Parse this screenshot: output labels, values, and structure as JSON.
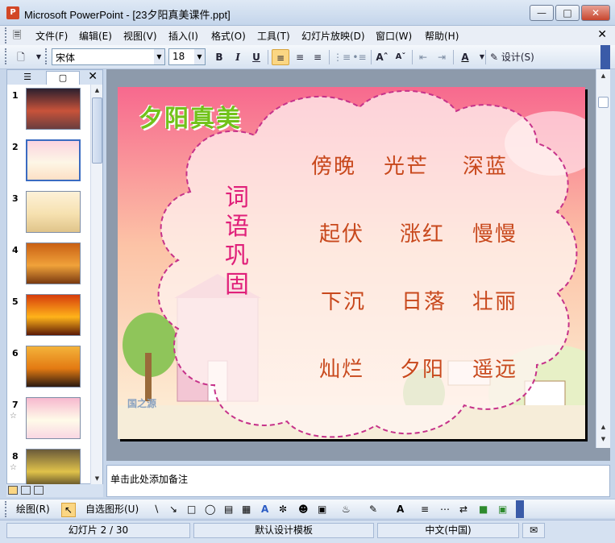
{
  "window": {
    "title": "Microsoft PowerPoint - [23夕阳真美课件.ppt]",
    "app_icon_glyph": "P"
  },
  "menu": [
    "文件(F)",
    "编辑(E)",
    "视图(V)",
    "插入(I)",
    "格式(O)",
    "工具(T)",
    "幻灯片放映(D)",
    "窗口(W)",
    "帮助(H)"
  ],
  "toolbar": {
    "font_name": "宋体",
    "font_size": "18",
    "bold": "B",
    "italic": "I",
    "underline": "U",
    "design_label": "设计(S)"
  },
  "panel_tabs": [
    "☰",
    "▢"
  ],
  "slides": [
    {
      "num": "1",
      "star": "",
      "colors": [
        "#2b1f2e",
        "#c8533a",
        "#6a3e3e"
      ]
    },
    {
      "num": "2",
      "star": "",
      "colors": [
        "#fbd3df",
        "#fdf6e6",
        "#fde0c5"
      ]
    },
    {
      "num": "3",
      "star": "",
      "colors": [
        "#fdf1d8",
        "#f6e1b0",
        "#e0c48a"
      ]
    },
    {
      "num": "4",
      "star": "",
      "colors": [
        "#c96014",
        "#f0a23a",
        "#7a3a10"
      ]
    },
    {
      "num": "5",
      "star": "",
      "colors": [
        "#d63c0c",
        "#ffb31a",
        "#5c1a06"
      ]
    },
    {
      "num": "6",
      "star": "",
      "colors": [
        "#f4b33b",
        "#e37a12",
        "#2c1a10"
      ]
    },
    {
      "num": "7",
      "star": "☆",
      "colors": [
        "#f7b9cf",
        "#fffbe9",
        "#f9d7e3"
      ]
    },
    {
      "num": "8",
      "star": "☆",
      "colors": [
        "#6a5a3a",
        "#e0c24a",
        "#3a3020"
      ]
    }
  ],
  "slide": {
    "logo_text": "夕阳真美",
    "title_vertical": [
      "词",
      "语",
      "巩",
      "固"
    ],
    "words": [
      [
        "傍晚",
        "光芒",
        "深蓝"
      ],
      [
        "起伏",
        "涨红",
        "慢慢"
      ],
      [
        "下沉",
        "日落",
        "壮丽"
      ],
      [
        "灿烂",
        "夕阳",
        "遥远"
      ]
    ],
    "watermark": "国之源"
  },
  "notes_placeholder": "单击此处添加备注",
  "drawbar": {
    "draw_label": "绘图(R)",
    "autoshapes_label": "自选图形(U)"
  },
  "status": {
    "slide_info": "幻灯片 2 / 30",
    "template": "默认设计模板",
    "language": "中文(中国)"
  },
  "colors": {
    "accent_word": "#c8481c",
    "accent_title": "#e0207a",
    "logo_green": "#71c21a"
  }
}
